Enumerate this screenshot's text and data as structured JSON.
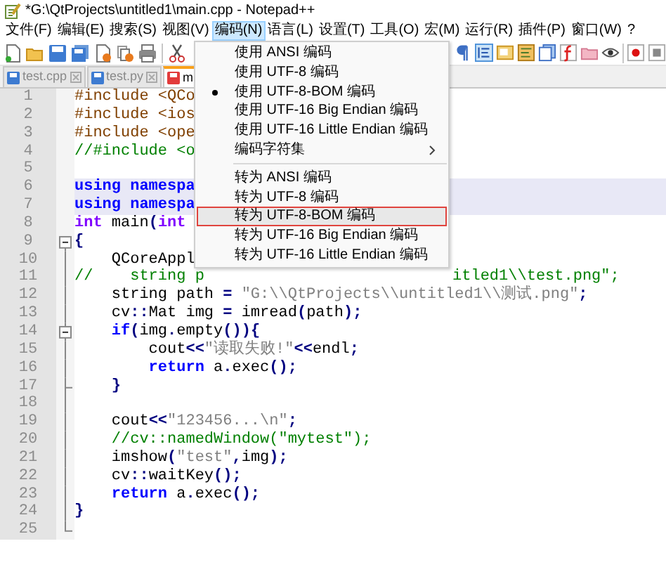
{
  "window": {
    "title": "*G:\\QtProjects\\untitled1\\main.cpp - Notepad++"
  },
  "menu_bar": [
    {
      "label": "文件(F)",
      "selected": false
    },
    {
      "label": "编辑(E)",
      "selected": false
    },
    {
      "label": "搜索(S)",
      "selected": false
    },
    {
      "label": "视图(V)",
      "selected": false
    },
    {
      "label": "编码(N)",
      "selected": true
    },
    {
      "label": "语言(L)",
      "selected": false
    },
    {
      "label": "设置(T)",
      "selected": false
    },
    {
      "label": "工具(O)",
      "selected": false
    },
    {
      "label": "宏(M)",
      "selected": false
    },
    {
      "label": "运行(R)",
      "selected": false
    },
    {
      "label": "插件(P)",
      "selected": false
    },
    {
      "label": "窗口(W)",
      "selected": false
    },
    {
      "label": "?",
      "selected": false
    }
  ],
  "tabs": [
    {
      "label": "test.cpp",
      "selected": false,
      "modified": false
    },
    {
      "label": "test.py",
      "selected": false,
      "modified": false
    },
    {
      "label": "m",
      "selected": true,
      "modified": true
    }
  ],
  "editor": {
    "lines": [
      {
        "number": "1",
        "highlighted": false,
        "fold_start": false,
        "fold_end": false,
        "tokens": [
          {
            "text": "#include <QCo",
            "kind": "pre"
          }
        ]
      },
      {
        "number": "2",
        "highlighted": false,
        "fold_start": false,
        "fold_end": false,
        "tokens": [
          {
            "text": "#include <ios",
            "kind": "pre"
          }
        ]
      },
      {
        "number": "3",
        "highlighted": false,
        "fold_start": false,
        "fold_end": false,
        "tokens": [
          {
            "text": "#include <ope",
            "kind": "pre"
          }
        ]
      },
      {
        "number": "4",
        "highlighted": false,
        "fold_start": false,
        "fold_end": false,
        "tokens": [
          {
            "text": "//#include <o",
            "kind": "comment"
          }
        ]
      },
      {
        "number": "5",
        "highlighted": false,
        "fold_start": false,
        "fold_end": false
      },
      {
        "number": "6",
        "highlighted": true,
        "fold_start": false,
        "fold_end": false,
        "tokens": [
          {
            "text": "using namespa",
            "kind": "keyword"
          }
        ]
      },
      {
        "number": "7",
        "highlighted": true,
        "fold_start": false,
        "fold_end": false,
        "tokens": [
          {
            "text": "using namespa",
            "kind": "keyword"
          }
        ]
      },
      {
        "number": "8",
        "highlighted": false,
        "fold_start": false,
        "fold_end": false,
        "tokens": [
          {
            "text": "int",
            "kind": "type"
          },
          {
            "text": " main",
            "kind": "plain"
          },
          {
            "text": "(",
            "kind": "op"
          },
          {
            "text": "int",
            "kind": "type"
          }
        ]
      },
      {
        "number": "9",
        "highlighted": false,
        "fold_start": true,
        "fold_end": false,
        "tokens": [
          {
            "text": "{",
            "kind": "op"
          }
        ]
      },
      {
        "number": "10",
        "highlighted": false,
        "fold_start": false,
        "fold_end": false,
        "tokens": [
          {
            "text": "    QCoreAppl",
            "kind": "plain"
          }
        ]
      },
      {
        "number": "11",
        "highlighted": false,
        "fold_start": false,
        "fold_end": false,
        "tokens": [
          {
            "text": "//    string p",
            "kind": "comment"
          }
        ],
        "right_tokens": [
          {
            "text": "itled1\\\\test.png\";",
            "kind": "comment"
          }
        ]
      },
      {
        "number": "12",
        "highlighted": false,
        "fold_start": false,
        "fold_end": false,
        "tokens": [
          {
            "text": "    string path ",
            "kind": "plain"
          },
          {
            "text": "=",
            "kind": "op"
          },
          {
            "text": " \"G:\\\\QtProjects\\\\untitled1\\\\测试.png\"",
            "kind": "string"
          },
          {
            "text": ";",
            "kind": "op"
          }
        ]
      },
      {
        "number": "13",
        "highlighted": false,
        "fold_start": false,
        "fold_end": false,
        "tokens": [
          {
            "text": "    cv",
            "kind": "plain"
          },
          {
            "text": "::",
            "kind": "op"
          },
          {
            "text": "Mat img ",
            "kind": "plain"
          },
          {
            "text": "=",
            "kind": "op"
          },
          {
            "text": " imread",
            "kind": "plain"
          },
          {
            "text": "(",
            "kind": "op"
          },
          {
            "text": "path",
            "kind": "plain"
          },
          {
            "text": ");",
            "kind": "op"
          }
        ]
      },
      {
        "number": "14",
        "highlighted": false,
        "fold_start": true,
        "fold_end": false,
        "tokens": [
          {
            "text": "    if",
            "kind": "keyword"
          },
          {
            "text": "(",
            "kind": "op"
          },
          {
            "text": "img",
            "kind": "plain"
          },
          {
            "text": ".",
            "kind": "op"
          },
          {
            "text": "empty",
            "kind": "plain"
          },
          {
            "text": "()){",
            "kind": "op"
          }
        ]
      },
      {
        "number": "15",
        "highlighted": false,
        "fold_start": false,
        "fold_end": false,
        "tokens": [
          {
            "text": "        cout",
            "kind": "plain"
          },
          {
            "text": "<<",
            "kind": "op"
          },
          {
            "text": "\"读取失败!\"",
            "kind": "string"
          },
          {
            "text": "<<",
            "kind": "op"
          },
          {
            "text": "endl",
            "kind": "plain"
          },
          {
            "text": ";",
            "kind": "op"
          }
        ]
      },
      {
        "number": "16",
        "highlighted": false,
        "fold_start": false,
        "fold_end": false,
        "tokens": [
          {
            "text": "        return",
            "kind": "keyword"
          },
          {
            "text": " a",
            "kind": "plain"
          },
          {
            "text": ".",
            "kind": "op"
          },
          {
            "text": "exec",
            "kind": "plain"
          },
          {
            "text": "();",
            "kind": "op"
          }
        ]
      },
      {
        "number": "17",
        "highlighted": false,
        "fold_start": false,
        "fold_end": true,
        "tokens": [
          {
            "text": "    }",
            "kind": "op"
          }
        ]
      },
      {
        "number": "18",
        "highlighted": false,
        "fold_start": false,
        "fold_end": false
      },
      {
        "number": "19",
        "highlighted": false,
        "fold_start": false,
        "fold_end": false,
        "tokens": [
          {
            "text": "    cout",
            "kind": "plain"
          },
          {
            "text": "<<",
            "kind": "op"
          },
          {
            "text": "\"123456...\\n\"",
            "kind": "string"
          },
          {
            "text": ";",
            "kind": "op"
          }
        ]
      },
      {
        "number": "20",
        "highlighted": false,
        "fold_start": false,
        "fold_end": false,
        "tokens": [
          {
            "text": "    //cv::namedWindow(\"mytest\");",
            "kind": "comment"
          }
        ]
      },
      {
        "number": "21",
        "highlighted": false,
        "fold_start": false,
        "fold_end": false,
        "tokens": [
          {
            "text": "    imshow",
            "kind": "plain"
          },
          {
            "text": "(",
            "kind": "op"
          },
          {
            "text": "\"test\"",
            "kind": "string"
          },
          {
            "text": ",",
            "kind": "op"
          },
          {
            "text": "img",
            "kind": "plain"
          },
          {
            "text": ");",
            "kind": "op"
          }
        ]
      },
      {
        "number": "22",
        "highlighted": false,
        "fold_start": false,
        "fold_end": false,
        "tokens": [
          {
            "text": "    cv",
            "kind": "plain"
          },
          {
            "text": "::",
            "kind": "op"
          },
          {
            "text": "waitKey",
            "kind": "plain"
          },
          {
            "text": "();",
            "kind": "op"
          }
        ]
      },
      {
        "number": "23",
        "highlighted": false,
        "fold_start": false,
        "fold_end": false,
        "tokens": [
          {
            "text": "    return",
            "kind": "keyword"
          },
          {
            "text": " a",
            "kind": "plain"
          },
          {
            "text": ".",
            "kind": "op"
          },
          {
            "text": "exec",
            "kind": "plain"
          },
          {
            "text": "();",
            "kind": "op"
          }
        ]
      },
      {
        "number": "24",
        "highlighted": false,
        "fold_start": false,
        "fold_end": false,
        "tokens": [
          {
            "text": "}",
            "kind": "op"
          }
        ]
      },
      {
        "number": "25",
        "highlighted": false,
        "fold_start": false,
        "fold_end": true
      }
    ]
  },
  "encoding_menu": {
    "items": [
      {
        "kind": "item",
        "label": "使用 ANSI 编码",
        "selected": false,
        "highlighted": false,
        "submenu": false
      },
      {
        "kind": "item",
        "label": "使用 UTF-8 编码",
        "selected": false,
        "highlighted": false,
        "submenu": false
      },
      {
        "kind": "item",
        "label": "使用 UTF-8-BOM 编码",
        "selected": true,
        "highlighted": false,
        "submenu": false
      },
      {
        "kind": "item",
        "label": "使用 UTF-16 Big Endian 编码",
        "selected": false,
        "highlighted": false,
        "submenu": false
      },
      {
        "kind": "item",
        "label": "使用 UTF-16 Little Endian 编码",
        "selected": false,
        "highlighted": false,
        "submenu": false
      },
      {
        "kind": "item",
        "label": "编码字符集",
        "selected": false,
        "highlighted": false,
        "submenu": true
      },
      {
        "kind": "separator"
      },
      {
        "kind": "item",
        "label": "转为 ANSI 编码",
        "selected": false,
        "highlighted": false,
        "submenu": false
      },
      {
        "kind": "item",
        "label": "转为 UTF-8 编码",
        "selected": false,
        "highlighted": false,
        "submenu": false
      },
      {
        "kind": "item",
        "label": "转为 UTF-8-BOM 编码",
        "selected": false,
        "highlighted": true,
        "submenu": false
      },
      {
        "kind": "item",
        "label": "转为 UTF-16 Big Endian 编码",
        "selected": false,
        "highlighted": false,
        "submenu": false
      },
      {
        "kind": "item",
        "label": "转为 UTF-16 Little Endian 编码",
        "selected": false,
        "highlighted": false,
        "submenu": false
      }
    ]
  }
}
